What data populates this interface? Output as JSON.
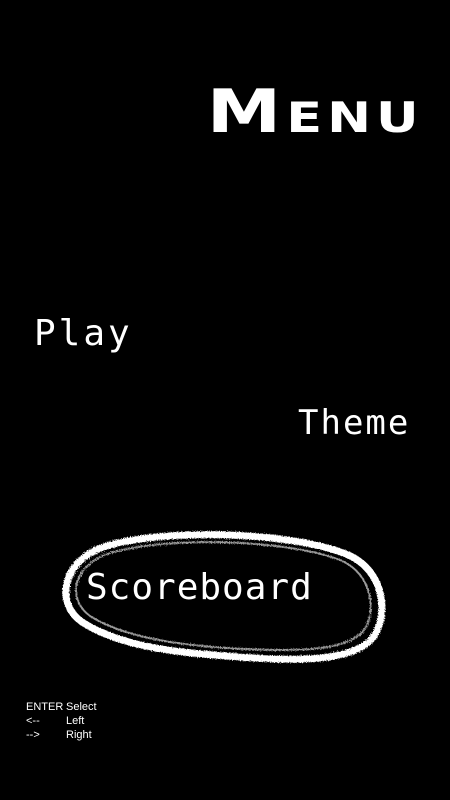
{
  "menu": {
    "title": "Menu",
    "items": [
      {
        "label": "Play"
      },
      {
        "label": "Theme"
      },
      {
        "label": "Scoreboard",
        "selected": true
      }
    ]
  },
  "controls": [
    {
      "key": "ENTER",
      "action": "Select"
    },
    {
      "key": "<--",
      "action": "Left"
    },
    {
      "key": "-->",
      "action": "Right"
    }
  ],
  "colors": {
    "background": "#000000",
    "text": "#ffffff",
    "selection_ring": "#ffffff"
  }
}
